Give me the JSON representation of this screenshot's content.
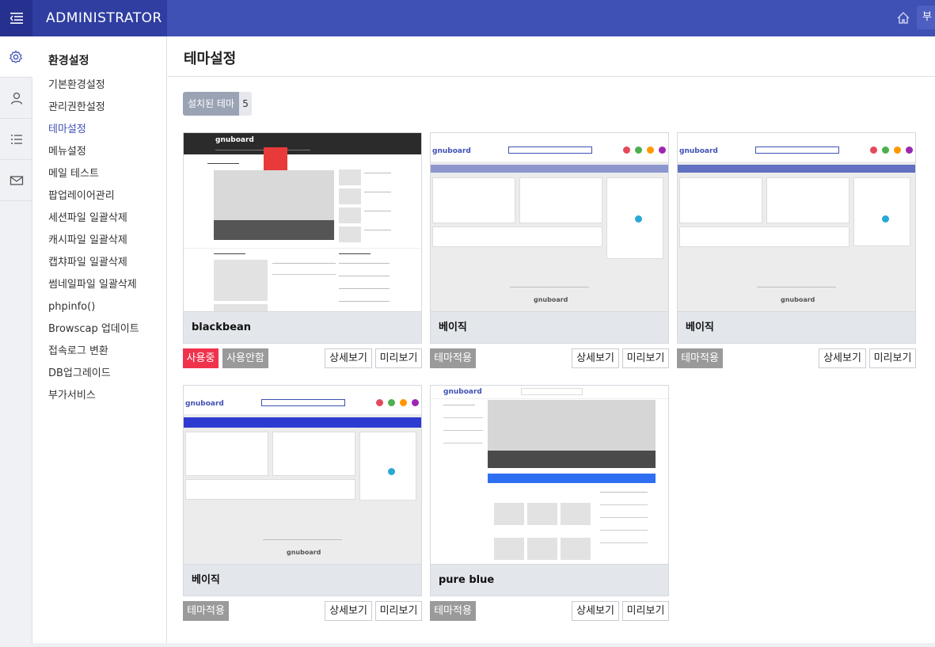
{
  "header": {
    "title": "ADMINISTRATOR",
    "extra": "부"
  },
  "submenu": {
    "heading": "환경설정",
    "items": [
      {
        "label": "기본환경설정"
      },
      {
        "label": "관리권한설정"
      },
      {
        "label": "테마설정"
      },
      {
        "label": "메뉴설정"
      },
      {
        "label": "메일 테스트"
      },
      {
        "label": "팝업레이어관리"
      },
      {
        "label": "세션파일 일괄삭제"
      },
      {
        "label": "캐시파일 일괄삭제"
      },
      {
        "label": "캡챠파일 일괄삭제"
      },
      {
        "label": "썸네일파일 일괄삭제"
      },
      {
        "label": "phpinfo()"
      },
      {
        "label": "Browscap 업데이트"
      },
      {
        "label": "접속로그 변환"
      },
      {
        "label": "DB업그레이드"
      },
      {
        "label": "부가서비스"
      }
    ]
  },
  "page": {
    "title": "테마설정",
    "installed_label": "설치된 테마",
    "installed_count": "5"
  },
  "themes": [
    {
      "name": "blackbean",
      "btn_use": "사용중",
      "btn_unuse": "사용안함",
      "btn_detail": "상세보기",
      "btn_preview": "미리보기",
      "logo": "gnuboard"
    },
    {
      "name": "베이직",
      "btn_apply": "테마적용",
      "btn_detail": "상세보기",
      "btn_preview": "미리보기",
      "logo": "gnuboard"
    },
    {
      "name": "베이직",
      "btn_apply": "테마적용",
      "btn_detail": "상세보기",
      "btn_preview": "미리보기",
      "logo": "gnuboard"
    },
    {
      "name": "베이직",
      "btn_apply": "테마적용",
      "btn_detail": "상세보기",
      "btn_preview": "미리보기",
      "logo": "gnuboard"
    },
    {
      "name": "pure blue",
      "btn_apply": "테마적용",
      "btn_detail": "상세보기",
      "btn_preview": "미리보기",
      "logo": "gnuboard"
    }
  ],
  "colors": {
    "primary": "#3f51b5",
    "active_red": "#f0334d",
    "muted_gray": "#9a9a9a"
  }
}
